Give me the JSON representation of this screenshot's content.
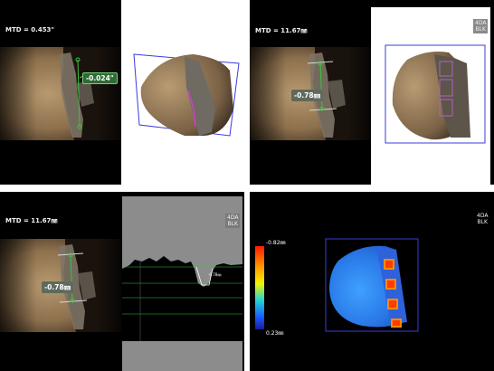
{
  "panels": {
    "tl": {
      "mtd": "MTD = 0.453\"",
      "measurement": "-0.024\""
    },
    "tr": {
      "mtd": "MTD = 11.67㎜",
      "measurement": "-0.78㎜",
      "badge_line1": "4DA",
      "badge_line2": "BLK"
    },
    "bl": {
      "mtd": "MTD = 11.67㎜",
      "measurement": "-0.78㎜",
      "badge_line1": "4DA",
      "badge_line2": "BLK",
      "profile_marker": "-0.78㎜"
    },
    "br": {
      "badge_line1": "4DA",
      "badge_line2": "BLK",
      "scale_max": "-0.82㎜",
      "scale_min": "0.23㎜"
    }
  },
  "colors": {
    "panel_bg": "#000000",
    "measure_green": "#2e8b2e",
    "measure_gray": "#5f6a5c",
    "frame_blue": "#3b3bd8",
    "profile_gray": "#8c8c8c"
  },
  "icons": [
    "heatmap-scale-icon"
  ]
}
